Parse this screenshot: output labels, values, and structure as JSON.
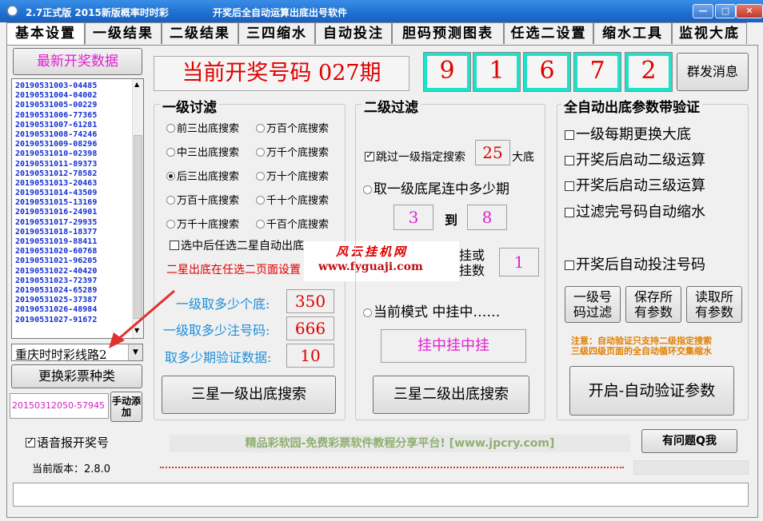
{
  "titlebar": {
    "title": "2.7正式版 2015新版概率时时彩",
    "subtitle": "开奖后全自动运算出底出号软件"
  },
  "tabs": [
    "基本设置",
    "一级结果",
    "二级结果",
    "三四缩水",
    "自动投注",
    "胆码预测图表",
    "任选二设置",
    "缩水工具",
    "监视大底"
  ],
  "left": {
    "latest_button": "最新开奖数据",
    "draws": [
      "20190531003-04485",
      "20190531004-04002",
      "20190531005-00229",
      "20190531006-77365",
      "20190531007-61281",
      "20190531008-74246",
      "20190531009-08296",
      "20190531010-02398",
      "20190531011-89373",
      "20190531012-78582",
      "20190531013-20463",
      "20190531014-43509",
      "20190531015-13169",
      "20190531016-24901",
      "20190531017-29935",
      "20190531018-18377",
      "20190531019-88411",
      "20190531020-60768",
      "20190531021-96205",
      "20190531022-40420",
      "20190531023-72397",
      "20190531024-65289",
      "20190531025-37387",
      "20190531026-48984",
      "20190531027-91672"
    ],
    "line_select": "重庆时时彩线路2",
    "change_button": "更换彩票种类",
    "manual_input": "20150312050-57945",
    "manual_button": "手动添加",
    "voice_label": "语音报开奖号",
    "version": "当前版本：2.8.0"
  },
  "header": {
    "current_label": "当前开奖号码 027期",
    "numbers": [
      "9",
      "1",
      "6",
      "7",
      "2"
    ],
    "broadcast_button": "群发消息"
  },
  "g1": {
    "title": "一级讨滤",
    "radios": [
      "前三出底搜索",
      "万百个底搜索",
      "中三出底搜索",
      "万千个底搜索",
      "后三出底搜索",
      "万十个底搜索",
      "万百十底搜索",
      "千十个底搜索",
      "万千十底搜索",
      "千百个底搜索"
    ],
    "check": "选中后任选二星自动出底",
    "note": "二星出底在任选二页面设置",
    "f1_label": "一级取多少个底:",
    "f1_value": "350",
    "f2_label": "一级取多少注号码:",
    "f2_value": "666",
    "f3_label": "取多少期验证数据:",
    "f3_value": "10",
    "search_button": "三星一级出底搜索"
  },
  "g2": {
    "title": "二级过滤",
    "skip_label": "跳过一级指定搜索",
    "skip_value": "25",
    "skip_suffix": "大底",
    "range_label": "取一级底尾连中多少期",
    "range_from": "3",
    "range_to_label": "到",
    "range_to": "8",
    "hang_label": "挂或\n挂数",
    "hang_value": "1",
    "mode_label": "当前模式  中挂中……",
    "mode_display": "挂中挂中挂",
    "search_button": "三星二级出底搜索"
  },
  "g3": {
    "title": "全自动出底参数带验证",
    "checks": [
      "一级每期更换大底",
      "开奖后启动二级运算",
      "开奖后启动三级运算",
      "过滤完号码自动缩水"
    ],
    "check5": "开奖后自动投注号码",
    "btn1": "一级号\n码过滤",
    "btn2": "保存所\n有参数",
    "btn3": "读取所\n有参数",
    "note1": "注意：自动验证只支持二级指定搜索",
    "note2": "三级四级页面的全自动循环交集缩水",
    "start_button": "开启-自动验证参数"
  },
  "footer": {
    "promo": "精品彩软园-免费彩票软件教程分享平台!  [www.jpcry.com]",
    "help_button": "有问题Q我"
  },
  "watermark": {
    "line1": "风云挂机网",
    "line2": "www.fyguaji.com"
  },
  "colors": {
    "accent_red": "#e00000",
    "accent_blue": "#1530d0",
    "cyan_border": "#1fe0c8",
    "magenta": "#e020d0"
  }
}
